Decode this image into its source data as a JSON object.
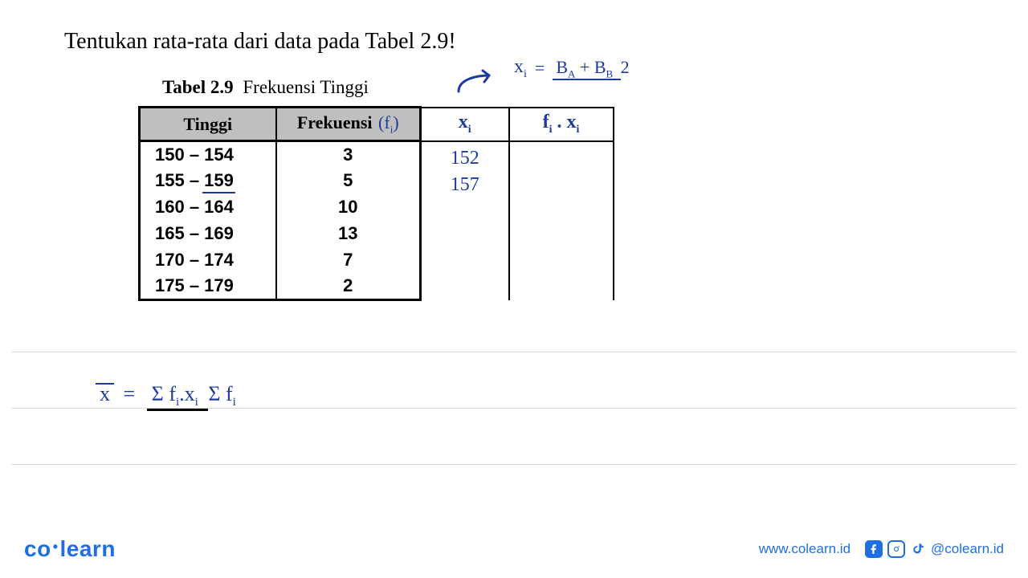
{
  "title": "Tentukan rata-rata dari data pada Tabel 2.9!",
  "caption": {
    "number": "Tabel 2.9",
    "text": "Frekuensi Tinggi"
  },
  "colors": {
    "accent": "#1d3a9e",
    "brand": "#1f6fe0"
  },
  "header": {
    "c1": "Tinggi",
    "c2": "Frekuensi",
    "c2_note_left": "(f",
    "c2_note_sub": "i",
    "c2_note_right": ")",
    "c3_sym": "x",
    "c3_sub": "i",
    "c4_left": "f",
    "c4_left_sub": "i",
    "c4_dot": " . ",
    "c4_right": "x",
    "c4_right_sub": "i"
  },
  "rows": [
    {
      "range": "150 – 154",
      "f": "3",
      "xi": "152"
    },
    {
      "range": "155 – 159",
      "f": "5",
      "xi": "157",
      "underline_end": true
    },
    {
      "range": "160 – 164",
      "f": "10",
      "xi": ""
    },
    {
      "range": "165 – 169",
      "f": "13",
      "xi": ""
    },
    {
      "range": "170 – 174",
      "f": "7",
      "xi": ""
    },
    {
      "range": "175 – 179",
      "f": "2",
      "xi": ""
    }
  ],
  "formula_top": {
    "lhs_sym": "x",
    "lhs_sub": "i",
    "eq": "=",
    "num_left": "B",
    "num_left_sub": "A",
    "num_plus": " + ",
    "num_right": "B",
    "num_right_sub": "B",
    "den": "2"
  },
  "formula_bottom": {
    "xbar": "x",
    "eq": "=",
    "num_sigma": "Σ ",
    "num_f": "f",
    "num_f_sub": "i",
    "num_dot": ".",
    "num_x": "x",
    "num_x_sub": "i",
    "den_sigma": "Σ ",
    "den_f": "f",
    "den_f_sub": "i"
  },
  "chart_data": {
    "type": "table",
    "title": "Tabel 2.9 Frekuensi Tinggi",
    "columns": [
      "Tinggi",
      "Frekuensi (fi)",
      "xi",
      "fi.xi"
    ],
    "rows": [
      [
        "150 – 154",
        3,
        152,
        null
      ],
      [
        "155 – 159",
        5,
        157,
        null
      ],
      [
        "160 – 164",
        10,
        null,
        null
      ],
      [
        "165 – 169",
        13,
        null,
        null
      ],
      [
        "170 – 174",
        7,
        null,
        null
      ],
      [
        "175 – 179",
        2,
        null,
        null
      ]
    ],
    "formulas": {
      "midpoint": "xi = (BA + BB) / 2",
      "mean": "x̄ = Σ fi·xi / Σ fi"
    }
  },
  "footer": {
    "brand_left": "co",
    "brand_right": "learn",
    "site": "www.colearn.id",
    "handle": "@colearn.id"
  }
}
